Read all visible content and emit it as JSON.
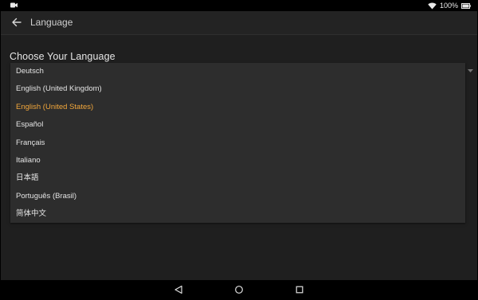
{
  "status_bar": {
    "battery_percent": "100%",
    "icons": [
      "camera-icon",
      "wifi-icon",
      "battery-icon"
    ]
  },
  "app_bar": {
    "title": "Language",
    "back_icon": "back-arrow-icon"
  },
  "section": {
    "heading": "Choose Your Language"
  },
  "dropdown": {
    "selected": "English (United States)",
    "options": [
      "Deutsch",
      "English (United Kingdom)",
      "English (United States)",
      "Español",
      "Français",
      "Italiano",
      "日本語",
      "Português (Brasil)",
      "简体中文"
    ],
    "accent_color": "#f2a73b"
  },
  "nav_bar": {
    "icons": [
      "back-triangle-icon",
      "home-circle-icon",
      "recents-square-icon"
    ]
  }
}
